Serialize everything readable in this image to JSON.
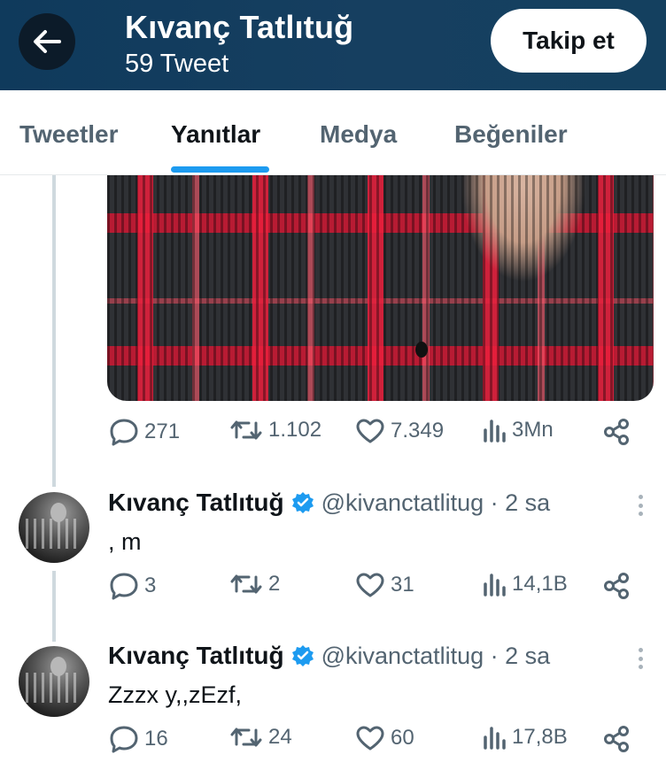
{
  "header": {
    "title": "Kıvanç Tatlıtuğ",
    "subtitle": "59 Tweet",
    "follow_label": "Takip et"
  },
  "tabs": [
    {
      "label": "Tweetler",
      "active": false
    },
    {
      "label": "Yanıtlar",
      "active": true
    },
    {
      "label": "Medya",
      "active": false
    },
    {
      "label": "Beğeniler",
      "active": false
    }
  ],
  "colors": {
    "accent": "#1d9bf0",
    "header_bg": "#163f60",
    "muted": "#536471",
    "verified": "#1d9bf0"
  },
  "media_tweet": {
    "replies": "271",
    "retweets": "1.102",
    "likes": "7.349",
    "views": "3Mn"
  },
  "tweets": [
    {
      "name": "Kıvanç Tatlıtuğ",
      "meta": "@kivanctatlitug · 2 sa",
      "text": ", m",
      "replies": "3",
      "retweets": "2",
      "likes": "31",
      "views": "14,1B"
    },
    {
      "name": "Kıvanç Tatlıtuğ",
      "meta": "@kivanctatlitug · 2 sa",
      "text": "Zzzx y,,zEzf,",
      "replies": "16",
      "retweets": "24",
      "likes": "60",
      "views": "17,8B"
    }
  ],
  "icons": [
    "back-arrow-icon",
    "reply-icon",
    "retweet-icon",
    "like-icon",
    "views-icon",
    "share-icon",
    "verified-badge-icon",
    "more-options-icon"
  ]
}
